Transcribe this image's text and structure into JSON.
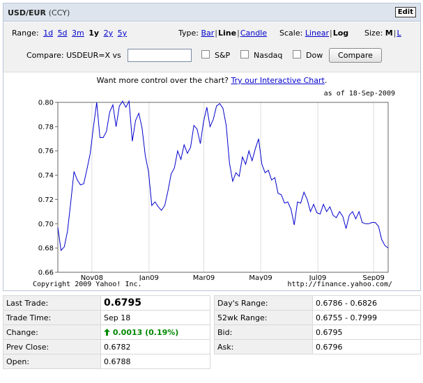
{
  "header": {
    "title": "USD/EUR",
    "ccy": "(CCY)",
    "edit_label": "Edit"
  },
  "controls": {
    "range_label": "Range:",
    "ranges": [
      "1d",
      "5d",
      "3m",
      "1y",
      "2y",
      "5y"
    ],
    "range_selected": "1y",
    "type_label": "Type:",
    "types": [
      "Bar",
      "Line",
      "Candle"
    ],
    "type_selected": "Line",
    "scale_label": "Scale:",
    "scales": [
      "Linear",
      "Log"
    ],
    "scale_selected": "Log",
    "size_label": "Size:",
    "sizes": [
      "M",
      "L"
    ],
    "size_selected": "M",
    "compare_label": "Compare: USDEUR=X vs",
    "compare_value": "",
    "checkboxes": [
      "S&P",
      "Nasdaq",
      "Dow"
    ],
    "compare_button": "Compare"
  },
  "promo": {
    "text": "Want more control over the chart?",
    "link": "Try our Interactive Chart",
    "suffix": "."
  },
  "chart_meta": {
    "asof": "as of 18-Sep-2009",
    "copyright": "Copyright 2009 Yahoo! Inc.",
    "source": "http://finance.yahoo.com/"
  },
  "chart_data": {
    "type": "line",
    "ylim": [
      0.66,
      0.8
    ],
    "yticks": [
      "0.80",
      "0.78",
      "0.76",
      "0.74",
      "0.72",
      "0.70",
      "0.68",
      "0.66"
    ],
    "xticks": [
      {
        "label": "Nov08",
        "pos": 0.103
      },
      {
        "label": "Jan09",
        "pos": 0.276
      },
      {
        "label": "Mar09",
        "pos": 0.442
      },
      {
        "label": "May09",
        "pos": 0.614
      },
      {
        "label": "Jul09",
        "pos": 0.787
      },
      {
        "label": "Sep09",
        "pos": 0.956
      }
    ],
    "series": [
      {
        "values": [
          0.697,
          0.678,
          0.681,
          0.694,
          0.718,
          0.743,
          0.736,
          0.732,
          0.733,
          0.745,
          0.758,
          0.78,
          0.8,
          0.771,
          0.771,
          0.776,
          0.792,
          0.798,
          0.78,
          0.797,
          0.801,
          0.796,
          0.801,
          0.768,
          0.785,
          0.791,
          0.779,
          0.756,
          0.743,
          0.715,
          0.718,
          0.714,
          0.711,
          0.715,
          0.727,
          0.741,
          0.746,
          0.76,
          0.753,
          0.765,
          0.758,
          0.763,
          0.781,
          0.778,
          0.766,
          0.784,
          0.796,
          0.78,
          0.786,
          0.797,
          0.799,
          0.795,
          0.781,
          0.75,
          0.735,
          0.742,
          0.739,
          0.755,
          0.749,
          0.76,
          0.752,
          0.762,
          0.77,
          0.749,
          0.742,
          0.744,
          0.736,
          0.738,
          0.725,
          0.724,
          0.717,
          0.718,
          0.712,
          0.699,
          0.718,
          0.717,
          0.726,
          0.72,
          0.71,
          0.716,
          0.709,
          0.708,
          0.716,
          0.71,
          0.714,
          0.707,
          0.705,
          0.71,
          0.706,
          0.696,
          0.707,
          0.71,
          0.704,
          0.71,
          0.701,
          0.7,
          0.7,
          0.701,
          0.701,
          0.698,
          0.687,
          0.682,
          0.68
        ]
      }
    ]
  },
  "stats_left": [
    {
      "label": "Last Trade:",
      "value": "0.6795"
    },
    {
      "label": "Trade Time:",
      "value": "Sep 18"
    },
    {
      "label": "Change:",
      "value": "0.0013 (0.19%)"
    },
    {
      "label": "Prev Close:",
      "value": "0.6782"
    },
    {
      "label": "Open:",
      "value": "0.6788"
    }
  ],
  "stats_right": [
    {
      "label": "Day's Range:",
      "value": "0.6786 - 0.6826"
    },
    {
      "label": "52wk Range:",
      "value": "0.6755 - 0.7999"
    },
    {
      "label": "Bid:",
      "value": "0.6795"
    },
    {
      "label": "Ask:",
      "value": "0.6796"
    }
  ],
  "colors": {
    "line": "#0000cc",
    "change_up": "#008800"
  }
}
